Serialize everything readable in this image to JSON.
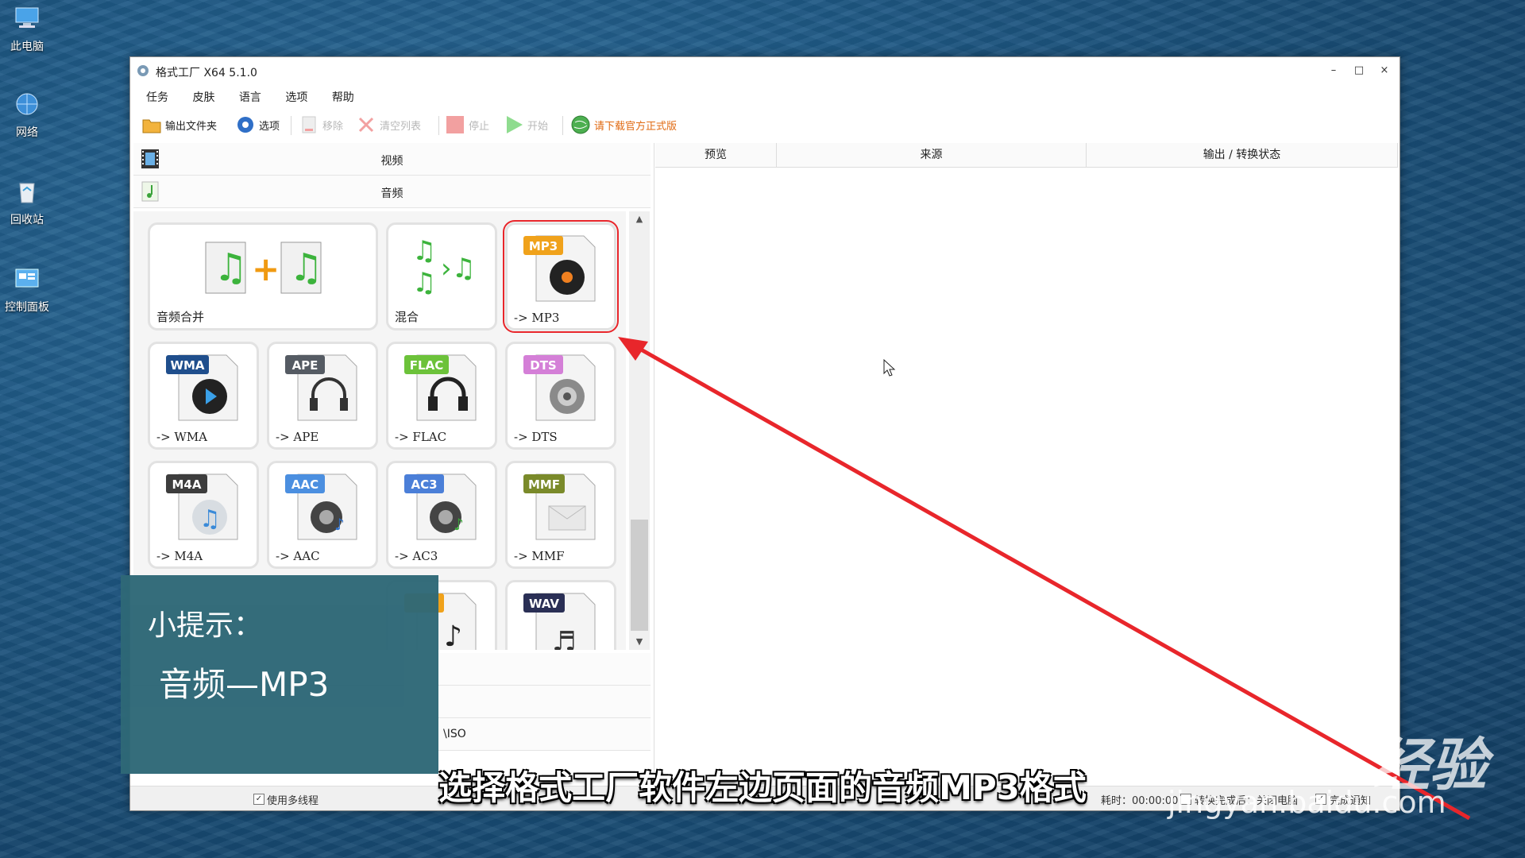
{
  "desktop": {
    "icons": [
      {
        "label": "此电脑"
      },
      {
        "label": "网络"
      },
      {
        "label": "回收站"
      },
      {
        "label": "控制面板"
      }
    ]
  },
  "window": {
    "title": "格式工厂 X64 5.1.0",
    "controls": {
      "minimize": "–",
      "maximize": "□",
      "close": "×"
    }
  },
  "menu": [
    "任务",
    "皮肤",
    "语言",
    "选项",
    "帮助"
  ],
  "toolbar": {
    "output_folder": "输出文件夹",
    "options": "选项",
    "remove": "移除",
    "clear_list": "清空列表",
    "stop": "停止",
    "start": "开始",
    "download": "请下载官方正式版"
  },
  "left": {
    "categories": {
      "video": "视频",
      "audio": "音频"
    },
    "tiles": [
      {
        "caption": "音频合并"
      },
      {
        "caption": "混合"
      },
      {
        "caption": "-> MP3",
        "badge": "MP3",
        "badge_color": "#f0a21b"
      },
      {
        "caption": "-> WMA",
        "badge": "WMA",
        "badge_color": "#1f4e8c"
      },
      {
        "caption": "-> APE",
        "badge": "APE",
        "badge_color": "#555b63"
      },
      {
        "caption": "-> FLAC",
        "badge": "FLAC",
        "badge_color": "#6cc23a"
      },
      {
        "caption": "-> DTS",
        "badge": "DTS",
        "badge_color": "#d47fd7"
      },
      {
        "caption": "-> M4A",
        "badge": "M4A",
        "badge_color": "#3d3d3d"
      },
      {
        "caption": "-> AAC",
        "badge": "AAC",
        "badge_color": "#4b8fe0"
      },
      {
        "caption": "-> AC3",
        "badge": "AC3",
        "badge_color": "#4b7fd8"
      },
      {
        "caption": "-> MMF",
        "badge": "MMF",
        "badge_color": "#7a8a2a"
      },
      {
        "caption": "",
        "badge": "",
        "badge_color": "#f0a21b"
      },
      {
        "caption": "",
        "badge": "WAV",
        "badge_color": "#2a2f55"
      }
    ],
    "lower_rows": [
      "",
      "",
      "\\ISO"
    ]
  },
  "right": {
    "columns": [
      "预览",
      "来源",
      "输出 / 转换状态"
    ]
  },
  "status": {
    "multithread": "使用多线程",
    "elapsed": "耗时：00:00:00",
    "after_convert": "转换完成后：关闭电脑",
    "notify": "完成通知"
  },
  "tip": {
    "title": "小提示：",
    "text": "音频—MP3"
  },
  "subtitle": "选择格式工厂软件左边页面的音频MP3格式",
  "watermark": {
    "brand": "Baidu 经验",
    "url": "jingyan.baidu.com"
  },
  "colors": {
    "highlight": "#e8262b",
    "tip_bg": "#2e6877",
    "promo": "#e06a12"
  }
}
